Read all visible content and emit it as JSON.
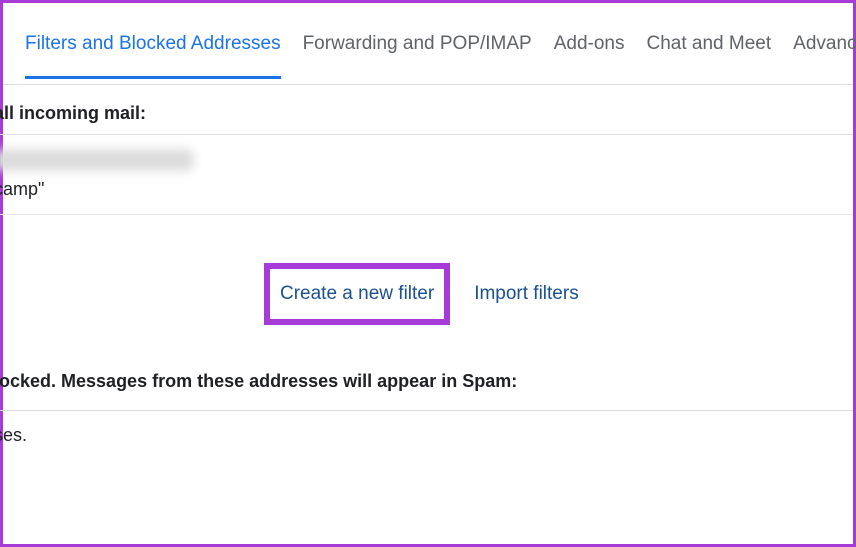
{
  "tabs": [
    {
      "label": "Filters and Blocked Addresses",
      "active": true
    },
    {
      "label": "Forwarding and POP/IMAP",
      "active": false
    },
    {
      "label": "Add-ons",
      "active": false
    },
    {
      "label": "Chat and Meet",
      "active": false
    },
    {
      "label": "Advanced",
      "active": false
    }
  ],
  "filters": {
    "header": "all incoming mail:",
    "item_text": "camp\""
  },
  "actions": {
    "create": "Create a new filter",
    "import": "Import filters"
  },
  "blocked": {
    "header": "locked. Messages from these addresses will appear in Spam:",
    "content": "ses."
  }
}
